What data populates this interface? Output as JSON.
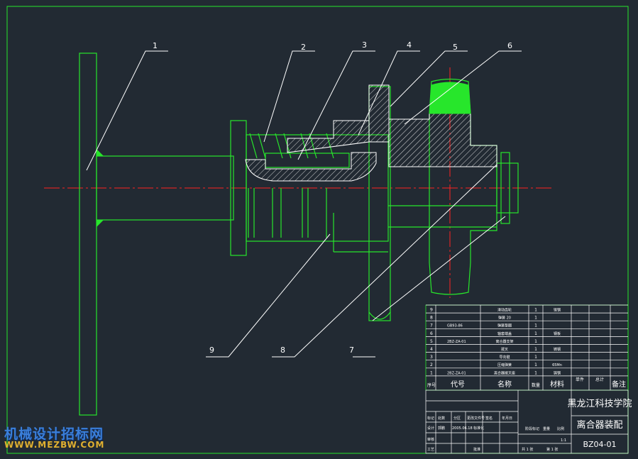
{
  "drawing": {
    "title_school": "黑龙江科技学院",
    "title_name": "离合器装配",
    "drawing_no": "BZ04-01",
    "scale": "1:1",
    "sheet_total": "共 1 张",
    "sheet_no": "第 1 张"
  },
  "leaders": [
    "1",
    "2",
    "3",
    "4",
    "5",
    "6",
    "7",
    "8",
    "9"
  ],
  "bom_header": [
    "序号",
    "代号",
    "名称",
    "数量",
    "材料",
    "单件",
    "总计",
    "备注"
  ],
  "bom_rows": [
    {
      "no": "9",
      "code": "",
      "name": "滑动齿轮",
      "qty": "1",
      "mat": "锻钢"
    },
    {
      "no": "8",
      "code": "",
      "name": "弹簧 20",
      "qty": "1",
      "mat": ""
    },
    {
      "no": "7",
      "code": "GB93-86",
      "name": "弹簧垫圈",
      "qty": "1",
      "mat": ""
    },
    {
      "no": "6",
      "code": "",
      "name": "轴套端盖",
      "qty": "1",
      "mat": "钢板"
    },
    {
      "no": "5",
      "code": "2BZ-ZA-01",
      "name": "离合器支架",
      "qty": "1",
      "mat": ""
    },
    {
      "no": "4",
      "code": "",
      "name": "拨叉",
      "qty": "1",
      "mat": "铸钢"
    },
    {
      "no": "3",
      "code": "",
      "name": "导向键",
      "qty": "1",
      "mat": ""
    },
    {
      "no": "2",
      "code": "",
      "name": "压缩弹簧",
      "qty": "1",
      "mat": "65Mn"
    },
    {
      "no": "1",
      "code": "2BZ-ZA-01",
      "name": "离合器拨叉座",
      "qty": "1",
      "mat": "铸钢"
    }
  ],
  "title_block_labels": {
    "mark": "标记",
    "count": "处数",
    "zone": "分区",
    "change_doc": "更改文件号",
    "sign": "签名",
    "date": "年月日",
    "designer": "设计",
    "standard": "标准化",
    "stage": "阶段标记",
    "weight": "重量",
    "scale": "比例",
    "audit": "审核",
    "process": "工艺",
    "approve": "批准",
    "designer_name": "郭鹏",
    "designer_date": "2005.06.18"
  },
  "watermark": {
    "line1": "机械设计招标网",
    "line2": "WWW.MEZBW.COM"
  },
  "colors": {
    "bg": "#222a33",
    "frame": "#27e62b",
    "line": "#ffffff",
    "center": "#ff2222",
    "hatch": "#d8d8d8",
    "text": "#ffffff"
  }
}
